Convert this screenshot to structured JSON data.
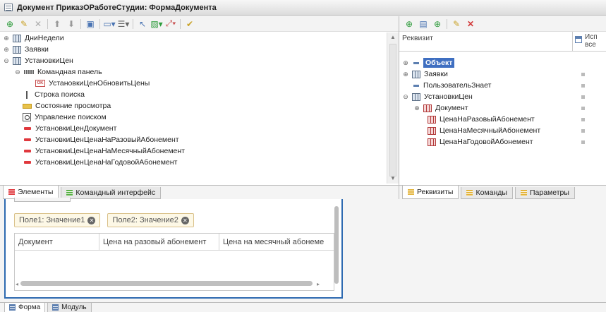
{
  "window": {
    "title": "Документ ПриказОРаботеСтудии: ФормаДокумента"
  },
  "elements_tree": {
    "items": [
      {
        "label": "ДниНедели",
        "level": 0,
        "icon": "table-icon",
        "expander": "⊕"
      },
      {
        "label": "Заявки",
        "level": 0,
        "icon": "table-icon",
        "expander": "⊕"
      },
      {
        "label": "УстановкиЦен",
        "level": 0,
        "icon": "table-icon",
        "expander": "⊖"
      },
      {
        "label": "Командная панель",
        "level": 1,
        "icon": "command-bar-icon",
        "expander": "⊖"
      },
      {
        "label": "УстановкиЦенОбновитьЦены",
        "level": 2,
        "icon": "ok-button-icon",
        "expander": ""
      },
      {
        "label": "Строка поиска",
        "level": 1,
        "icon": "search-line-icon",
        "expander": ""
      },
      {
        "label": "Состояние просмотра",
        "level": 1,
        "icon": "view-state-icon",
        "expander": ""
      },
      {
        "label": "Управление поиском",
        "level": 1,
        "icon": "search-control-icon",
        "expander": ""
      },
      {
        "label": "УстановкиЦенДокумент",
        "level": 1,
        "icon": "field-icon",
        "expander": ""
      },
      {
        "label": "УстановкиЦенЦенаНаРазовыйАбонемент",
        "level": 1,
        "icon": "field-icon",
        "expander": ""
      },
      {
        "label": "УстановкиЦенЦенаНаМесячныйАбонемент",
        "level": 1,
        "icon": "field-icon",
        "expander": ""
      },
      {
        "label": "УстановкиЦенЦенаНаГодовойАбонемент",
        "level": 1,
        "icon": "field-icon",
        "expander": ""
      }
    ]
  },
  "left_tabs": {
    "elements": "Элементы",
    "command_interface": "Командный интерфейс"
  },
  "attributes": {
    "header_col1": "Реквизит",
    "header_col2_line1": "Исп",
    "header_col2_line2": "все",
    "items": [
      {
        "label": "Объект",
        "selected": true,
        "expander": "⊕",
        "icon": "dash-icon",
        "check": false
      },
      {
        "label": "Заявки",
        "selected": false,
        "expander": "⊕",
        "icon": "table-icon",
        "check": true
      },
      {
        "label": "ПользовательЗнает",
        "selected": false,
        "expander": "",
        "icon": "dash-icon",
        "check": true
      },
      {
        "label": "УстановкиЦен",
        "selected": false,
        "expander": "⊖",
        "icon": "table-icon",
        "check": true
      },
      {
        "label": "Документ",
        "selected": false,
        "expander": "⊕",
        "icon": "red-table-icon",
        "check": true
      },
      {
        "label": "ЦенаНаРазовыйАбонемент",
        "selected": false,
        "expander": "",
        "icon": "red-table-icon",
        "check": true
      },
      {
        "label": "ЦенаНаМесячныйАбонемент",
        "selected": false,
        "expander": "",
        "icon": "red-table-icon",
        "check": true
      },
      {
        "label": "ЦенаНаГодовойАбонемент",
        "selected": false,
        "expander": "",
        "icon": "red-table-icon",
        "check": true
      }
    ]
  },
  "right_tabs": {
    "attributes": "Реквизиты",
    "commands": "Команды",
    "parameters": "Параметры"
  },
  "preview": {
    "chip1": "Поле1: Значение1",
    "chip2": "Поле2: Значение2",
    "columns": [
      "Документ",
      "Цена на разовый абонемент",
      "Цена на месячный абонеме"
    ]
  },
  "bottom_tabs": {
    "form": "Форма",
    "module": "Модуль"
  },
  "colors": {
    "accent": "#2e6ab1",
    "selection": "#3f6fc1",
    "field_red": "#e0383d"
  }
}
